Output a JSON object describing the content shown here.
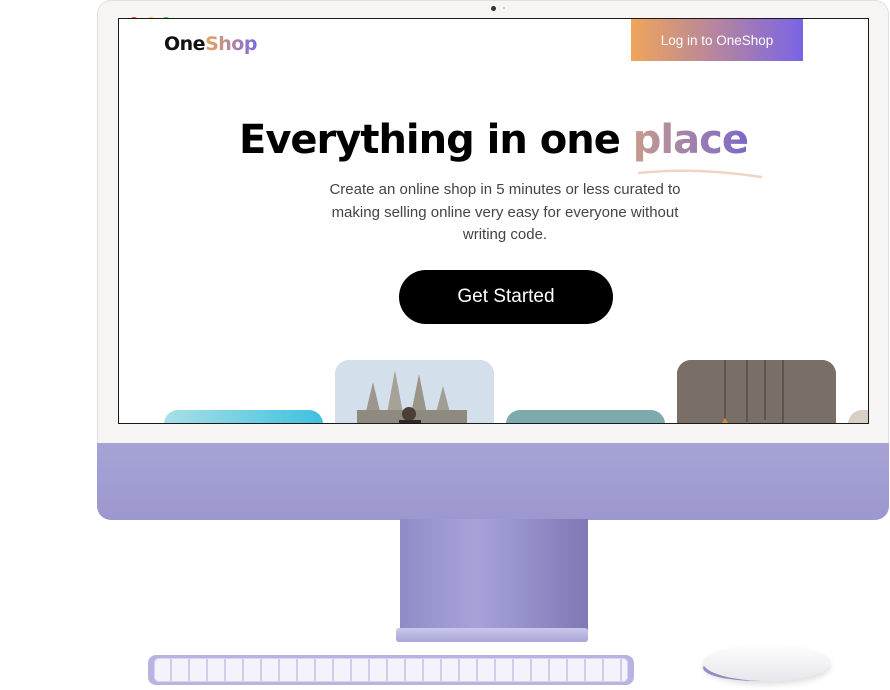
{
  "brand": {
    "name_part1": "One",
    "name_part2": "Shop"
  },
  "nav": {
    "login_label": "Log in to OneShop"
  },
  "hero": {
    "title_main": "Everything in one ",
    "title_accent": "place",
    "subtitle": "Create an online shop in 5 minutes or less curated to making selling online very easy for everyone without writing code.",
    "cta_label": "Get Started"
  },
  "colors": {
    "accent_orange": "#efa55a",
    "accent_purple": "#7a64e6",
    "imac_purple": "#a6a3d6"
  },
  "icons": [
    "window-close-dot-icon",
    "window-minimize-dot-icon",
    "window-maximize-dot-icon"
  ]
}
